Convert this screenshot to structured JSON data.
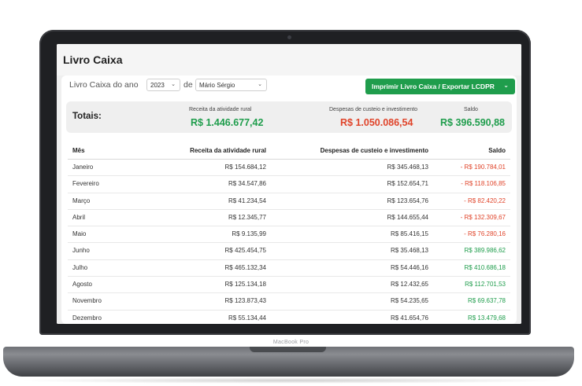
{
  "device": {
    "brand": "MacBook Pro"
  },
  "page": {
    "title": "Livro Caixa"
  },
  "filters": {
    "label": "Livro Caixa do ano",
    "year": "2023",
    "connector": "de",
    "user": "Mário Sérgio"
  },
  "actions": {
    "print_label": "Imprimir Livro Caixa / Exportar LCDPR"
  },
  "totals": {
    "label": "Totais:",
    "receita_caption": "Receita da atividade rural",
    "receita_value": "R$ 1.446.677,42",
    "despesas_caption": "Despesas de custeio e investimento",
    "despesas_value": "R$ 1.050.086,54",
    "saldo_caption": "Saldo",
    "saldo_value": "R$ 396.590,88"
  },
  "table": {
    "headers": [
      "Mês",
      "Receita da atividade rural",
      "Despesas de custeio e investimento",
      "Saldo"
    ],
    "rows": [
      {
        "mes": "Janeiro",
        "receita": "R$ 154.684,12",
        "despesas": "R$ 345.468,13",
        "saldo": "- R$ 190.784,01",
        "status": "neg"
      },
      {
        "mes": "Fevereiro",
        "receita": "R$ 34.547,86",
        "despesas": "R$ 152.654,71",
        "saldo": "- R$ 118.106,85",
        "status": "neg"
      },
      {
        "mes": "Março",
        "receita": "R$ 41.234,54",
        "despesas": "R$ 123.654,76",
        "saldo": "- R$ 82.420,22",
        "status": "neg"
      },
      {
        "mes": "Abril",
        "receita": "R$ 12.345,77",
        "despesas": "R$ 144.655,44",
        "saldo": "- R$ 132.309,67",
        "status": "neg"
      },
      {
        "mes": "Maio",
        "receita": "R$ 9.135,99",
        "despesas": "R$ 85.416,15",
        "saldo": "- R$ 76.280,16",
        "status": "neg"
      },
      {
        "mes": "Junho",
        "receita": "R$ 425.454,75",
        "despesas": "R$ 35.468,13",
        "saldo": "R$ 389.986,62",
        "status": "pos"
      },
      {
        "mes": "Julho",
        "receita": "R$ 465.132,34",
        "despesas": "R$ 54.446,16",
        "saldo": "R$ 410.686,18",
        "status": "pos"
      },
      {
        "mes": "Agosto",
        "receita": "R$ 125.134,18",
        "despesas": "R$ 12.432,65",
        "saldo": "R$ 112.701,53",
        "status": "pos"
      },
      {
        "mes": "Novembro",
        "receita": "R$ 123.873,43",
        "despesas": "R$ 54.235,65",
        "saldo": "R$ 69.637,78",
        "status": "pos"
      },
      {
        "mes": "Dezembro",
        "receita": "R$ 55.134,44",
        "despesas": "R$ 41.654,76",
        "saldo": "R$ 13.479,68",
        "status": "pos"
      }
    ]
  },
  "colors": {
    "positive": "#1f9d4c",
    "negative": "#e0442a",
    "accent": "#1f9d4c"
  }
}
